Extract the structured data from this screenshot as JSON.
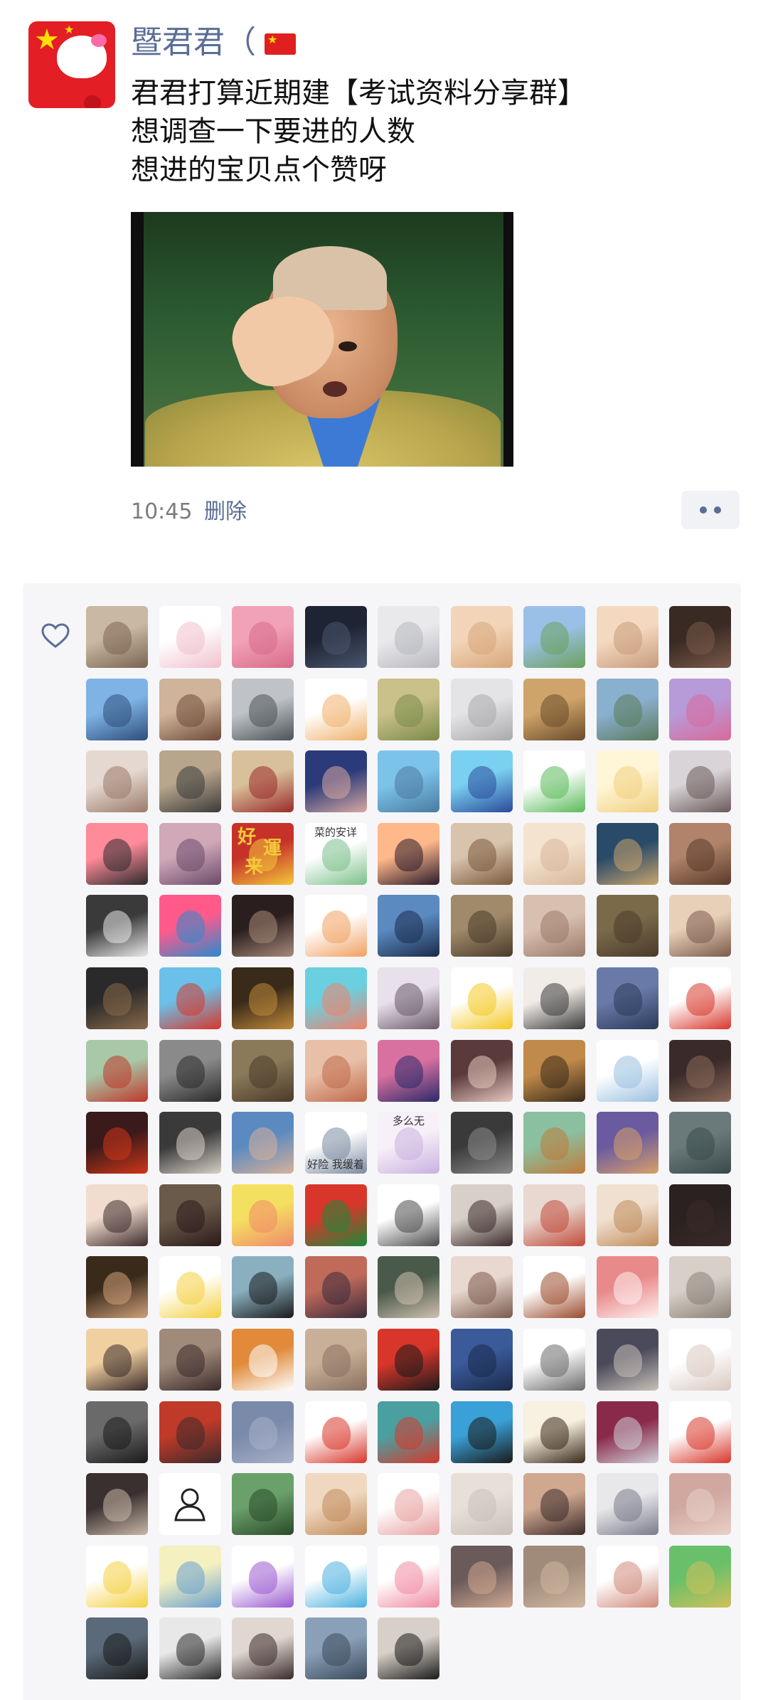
{
  "post": {
    "nickname": "暨君君（",
    "text_lines": [
      "君君打算近期建【考试资料分享群】",
      "想调查一下要进的人数",
      "想进的宝贝点个赞呀"
    ],
    "time": "10:45",
    "delete_label": "删除"
  },
  "likes": {
    "avatars": [
      {
        "c1": "#c9b8a3",
        "c2": "#7a6452"
      },
      {
        "c1": "#ffffff",
        "c2": "#f0c0cc"
      },
      {
        "c1": "#f2a2b8",
        "c2": "#d76a8a"
      },
      {
        "c1": "#1e2433",
        "c2": "#4a5670"
      },
      {
        "c1": "#e9e9ec",
        "c2": "#b7b8bd"
      },
      {
        "c1": "#f2d5b8",
        "c2": "#d7a57a"
      },
      {
        "c1": "#9bc0e8",
        "c2": "#69a15a"
      },
      {
        "c1": "#f4d9c0",
        "c2": "#c79a7a"
      },
      {
        "c1": "#3a2a24",
        "c2": "#7a5a4a"
      },
      {
        "c1": "#7fb3e6",
        "c2": "#2e4e7a"
      },
      {
        "c1": "#cfb39a",
        "c2": "#6e4a38"
      },
      {
        "c1": "#bfc3c7",
        "c2": "#4c5257"
      },
      {
        "c1": "#ffffff",
        "c2": "#f0b06a"
      },
      {
        "c1": "#c9c08a",
        "c2": "#7a8a48"
      },
      {
        "c1": "#e4e4e6",
        "c2": "#a9a9ab"
      },
      {
        "c1": "#cfa46a",
        "c2": "#6a4a2a"
      },
      {
        "c1": "#8ab0d0",
        "c2": "#5a7a5a"
      },
      {
        "c1": "#b79ad8",
        "c2": "#d86a9a"
      },
      {
        "c1": "#e5d8d0",
        "c2": "#9a7a6a"
      },
      {
        "c1": "#b8a58c",
        "c2": "#3a3a3a"
      },
      {
        "c1": "#d8c19a",
        "c2": "#9a2a2a"
      },
      {
        "c1": "#2a3a7a",
        "c2": "#d8a8a0"
      },
      {
        "c1": "#7cc3ea",
        "c2": "#4a7aa0"
      },
      {
        "c1": "#7ad0f0",
        "c2": "#2a4a9a"
      },
      {
        "c1": "#ffffff",
        "c2": "#5aba5a"
      },
      {
        "c1": "#fff6d8",
        "c2": "#f0d080"
      },
      {
        "c1": "#d9d4d8",
        "c2": "#6a5a5a"
      },
      {
        "c1": "#ff8a9a",
        "c2": "#2a2a2a"
      },
      {
        "c1": "#d0a8b8",
        "c2": "#6a4a6a"
      },
      {
        "c1": "#c6322a",
        "c2": "#f3c93a"
      },
      {
        "c1": "#ffffff",
        "c2": "#7ac08a"
      },
      {
        "c1": "#ffb88a",
        "c2": "#2a1a2a"
      },
      {
        "c1": "#d8c3ad",
        "c2": "#7a5a3a"
      },
      {
        "c1": "#f4e3cf",
        "c2": "#d7b79a"
      },
      {
        "c1": "#2a4a6a",
        "c2": "#c9a46a"
      },
      {
        "c1": "#b0836a",
        "c2": "#5a3a2a"
      },
      {
        "c1": "#3a3a3a",
        "c2": "#e9e9e9"
      },
      {
        "c1": "#ff5a8a",
        "c2": "#2a8ad0"
      },
      {
        "c1": "#2a1e1e",
        "c2": "#a88a7a"
      },
      {
        "c1": "#ffffff",
        "c2": "#f0a060"
      },
      {
        "c1": "#5a8ac0",
        "c2": "#1a2a4a"
      },
      {
        "c1": "#a08a6a",
        "c2": "#4a3a2a"
      },
      {
        "c1": "#d8c0b0",
        "c2": "#9a7a6a"
      },
      {
        "c1": "#7a6a4a",
        "c2": "#4a3a2a"
      },
      {
        "c1": "#e8d0b8",
        "c2": "#7a5a4a"
      },
      {
        "c1": "#2a2a2a",
        "c2": "#8a6a4a"
      },
      {
        "c1": "#6ac0e8",
        "c2": "#d8362a"
      },
      {
        "c1": "#3a2a1a",
        "c2": "#c08a3a"
      },
      {
        "c1": "#6ad0e0",
        "c2": "#f0806a"
      },
      {
        "c1": "#e8e0ea",
        "c2": "#6a5a6a"
      },
      {
        "c1": "#ffffff",
        "c2": "#f4c820"
      },
      {
        "c1": "#f2ece8",
        "c2": "#3a3a3a"
      },
      {
        "c1": "#6a7aa8",
        "c2": "#2a3a5a"
      },
      {
        "c1": "#ffffff",
        "c2": "#d8362a"
      },
      {
        "c1": "#a8c8a8",
        "c2": "#c0362a"
      },
      {
        "c1": "#8a8a8a",
        "c2": "#2a2a2a"
      },
      {
        "c1": "#8a7a5a",
        "c2": "#4a3a2a"
      },
      {
        "c1": "#e8c0a8",
        "c2": "#c06a4a"
      },
      {
        "c1": "#d870a0",
        "c2": "#2a2a6a"
      },
      {
        "c1": "#5a3a3a",
        "c2": "#e8c8c0"
      },
      {
        "c1": "#c08a4a",
        "c2": "#3a2a1a"
      },
      {
        "c1": "#ffffff",
        "c2": "#9ac0e0"
      },
      {
        "c1": "#3a2a2a",
        "c2": "#8a6a5a"
      },
      {
        "c1": "#3a1a1a",
        "c2": "#d0361a"
      },
      {
        "c1": "#3a3a3a",
        "c2": "#d8d0c8"
      },
      {
        "c1": "#5a8ac0",
        "c2": "#d8b09a"
      },
      {
        "c1": "#ffffff",
        "c2": "#7a8aa0"
      },
      {
        "c1": "#f8f0f8",
        "c2": "#c8b0e0"
      },
      {
        "c1": "#3a3a3a",
        "c2": "#8a8a8a"
      },
      {
        "c1": "#8ac0a0",
        "c2": "#c07a3a"
      },
      {
        "c1": "#6a5aa0",
        "c2": "#d8a06a"
      },
      {
        "c1": "#6a7a7a",
        "c2": "#3a4a4a"
      },
      {
        "c1": "#f2dccf",
        "c2": "#3a2a2a"
      },
      {
        "c1": "#6a5a4a",
        "c2": "#2a1a1a"
      },
      {
        "c1": "#f4e060",
        "c2": "#f08a6a"
      },
      {
        "c1": "#d8362a",
        "c2": "#1a8a3a"
      },
      {
        "c1": "#ffffff",
        "c2": "#4a4a4a"
      },
      {
        "c1": "#d8d0c8",
        "c2": "#3a2a2a"
      },
      {
        "c1": "#e8d8d0",
        "c2": "#c04a3a"
      },
      {
        "c1": "#f0e0d0",
        "c2": "#c08a5a"
      },
      {
        "c1": "#2a2220",
        "c2": "#3a2a2a"
      },
      {
        "c1": "#3a2a1a",
        "c2": "#d0a07a"
      },
      {
        "c1": "#ffffff",
        "c2": "#f4d040"
      },
      {
        "c1": "#8ab0c0",
        "c2": "#1a1a1a"
      },
      {
        "c1": "#c06a5a",
        "c2": "#3a2a3a"
      },
      {
        "c1": "#4a5a4a",
        "c2": "#d0c0b0"
      },
      {
        "c1": "#e8d8d0",
        "c2": "#7a5a4a"
      },
      {
        "c1": "#ffffff",
        "c2": "#9a4a2a"
      },
      {
        "c1": "#e88a8a",
        "c2": "#fff0f0"
      },
      {
        "c1": "#d8d0c8",
        "c2": "#8a8078"
      },
      {
        "c1": "#f0d0a0",
        "c2": "#3a2a2a"
      },
      {
        "c1": "#a08a7a",
        "c2": "#3a2a2a"
      },
      {
        "c1": "#e08a3a",
        "c2": "#ffffff"
      },
      {
        "c1": "#c8b098",
        "c2": "#8a7060"
      },
      {
        "c1": "#d8362a",
        "c2": "#1a1a1a"
      },
      {
        "c1": "#3a5a9a",
        "c2": "#1a2a4a"
      },
      {
        "c1": "#ffffff",
        "c2": "#6a6a6a"
      },
      {
        "c1": "#4a4a5a",
        "c2": "#c8c0b8"
      },
      {
        "c1": "#ffffff",
        "c2": "#d8c8c0"
      },
      {
        "c1": "#6a6a6a",
        "c2": "#1a1a1a"
      },
      {
        "c1": "#c03a2a",
        "c2": "#3a2a2a"
      },
      {
        "c1": "#7a8aaa",
        "c2": "#a8b0c8"
      },
      {
        "c1": "#ffffff",
        "c2": "#d8362a"
      },
      {
        "c1": "#4aa0a0",
        "c2": "#d8362a"
      },
      {
        "c1": "#3aa0d8",
        "c2": "#1a1a1a"
      },
      {
        "c1": "#f8f0e0",
        "c2": "#3a2a1a"
      },
      {
        "c1": "#8a2a4a",
        "c2": "#d0d0d8"
      },
      {
        "c1": "#ffffff",
        "c2": "#d8362a"
      },
      {
        "c1": "#3a3030",
        "c2": "#c8b8a8"
      },
      {
        "c1": "#ffffff",
        "c2": "#1a1a1a"
      },
      {
        "c1": "#6aa06a",
        "c2": "#2a4a2a"
      },
      {
        "c1": "#f0d8c0",
        "c2": "#c08a5a"
      },
      {
        "c1": "#ffffff",
        "c2": "#e8a0a0"
      },
      {
        "c1": "#e8e0d8",
        "c2": "#c8c0b8"
      },
      {
        "c1": "#d0a890",
        "c2": "#3a2a2a"
      },
      {
        "c1": "#e8e8ea",
        "c2": "#7a7a8a"
      },
      {
        "c1": "#d0a8a0",
        "c2": "#e8d0c8"
      },
      {
        "c1": "#ffffff",
        "c2": "#f4d040"
      },
      {
        "c1": "#f4f0c0",
        "c2": "#6aa0d0"
      },
      {
        "c1": "#ffffff",
        "c2": "#9a5ad0"
      },
      {
        "c1": "#ffffff",
        "c2": "#4ab0e0"
      },
      {
        "c1": "#ffffff",
        "c2": "#f08aa0"
      },
      {
        "c1": "#6a5a5a",
        "c2": "#d0a890"
      },
      {
        "c1": "#a08a7a",
        "c2": "#d0b8a0"
      },
      {
        "c1": "#ffffff",
        "c2": "#d08a7a"
      },
      {
        "c1": "#6ac06a",
        "c2": "#d0c05a"
      },
      {
        "c1": "#5a6a7a",
        "c2": "#1a1a1a"
      },
      {
        "c1": "#e8e8e8",
        "c2": "#2a2a2a"
      },
      {
        "c1": "#e0d8d0",
        "c2": "#3a2a2a"
      },
      {
        "c1": "#8aa0b8",
        "c2": "#3a4a5a"
      },
      {
        "c1": "#d8d0c8",
        "c2": "#1a1a1a"
      }
    ],
    "avatar_texts": {
      "29": {
        "line1": "好",
        "line2": "運",
        "line3": "来"
      },
      "30": {
        "top": "菜的安详"
      },
      "66": {
        "bottom": "好险 我缓着"
      },
      "67": {
        "top": "多么无"
      }
    },
    "default_avatar_index": 109
  },
  "colors": {
    "link_blue": "#5a6d95",
    "text_dark": "#111111",
    "time_gray": "#7c7c7c",
    "panel_bg": "#f6f6f8"
  },
  "icons": {
    "like": "heart-outline-icon",
    "more": "more-dots-icon",
    "default_avatar": "person-outline-icon"
  }
}
